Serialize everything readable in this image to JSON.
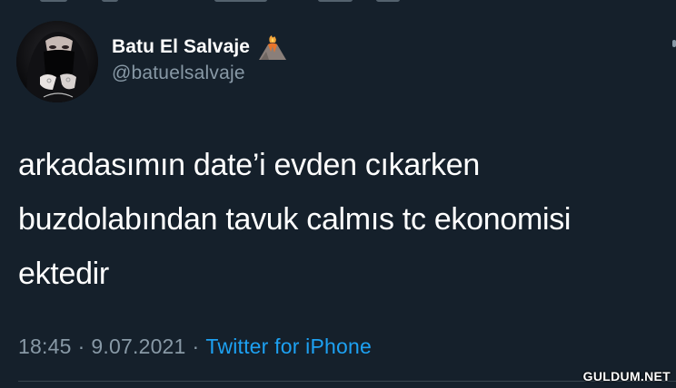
{
  "author": {
    "display_name": "Batu El Salvaje",
    "name_emoji": "volcano-icon",
    "handle": "@batuelsalvaje"
  },
  "tweet": {
    "lines": [
      "arkadasımın date’i evden cıkarken",
      "buzdolabından tavuk calmıs tc ekonomisi",
      "ektedir"
    ]
  },
  "meta": {
    "time": "18:45",
    "separator": "·",
    "date": "9.07.2021",
    "source": "Twitter for iPhone"
  },
  "watermark": "GULDUM.NET",
  "colors": {
    "background": "#15202b",
    "primary_text": "#ffffff",
    "secondary_text": "#8899a6",
    "link": "#1da1f2",
    "divider": "#38444d"
  }
}
